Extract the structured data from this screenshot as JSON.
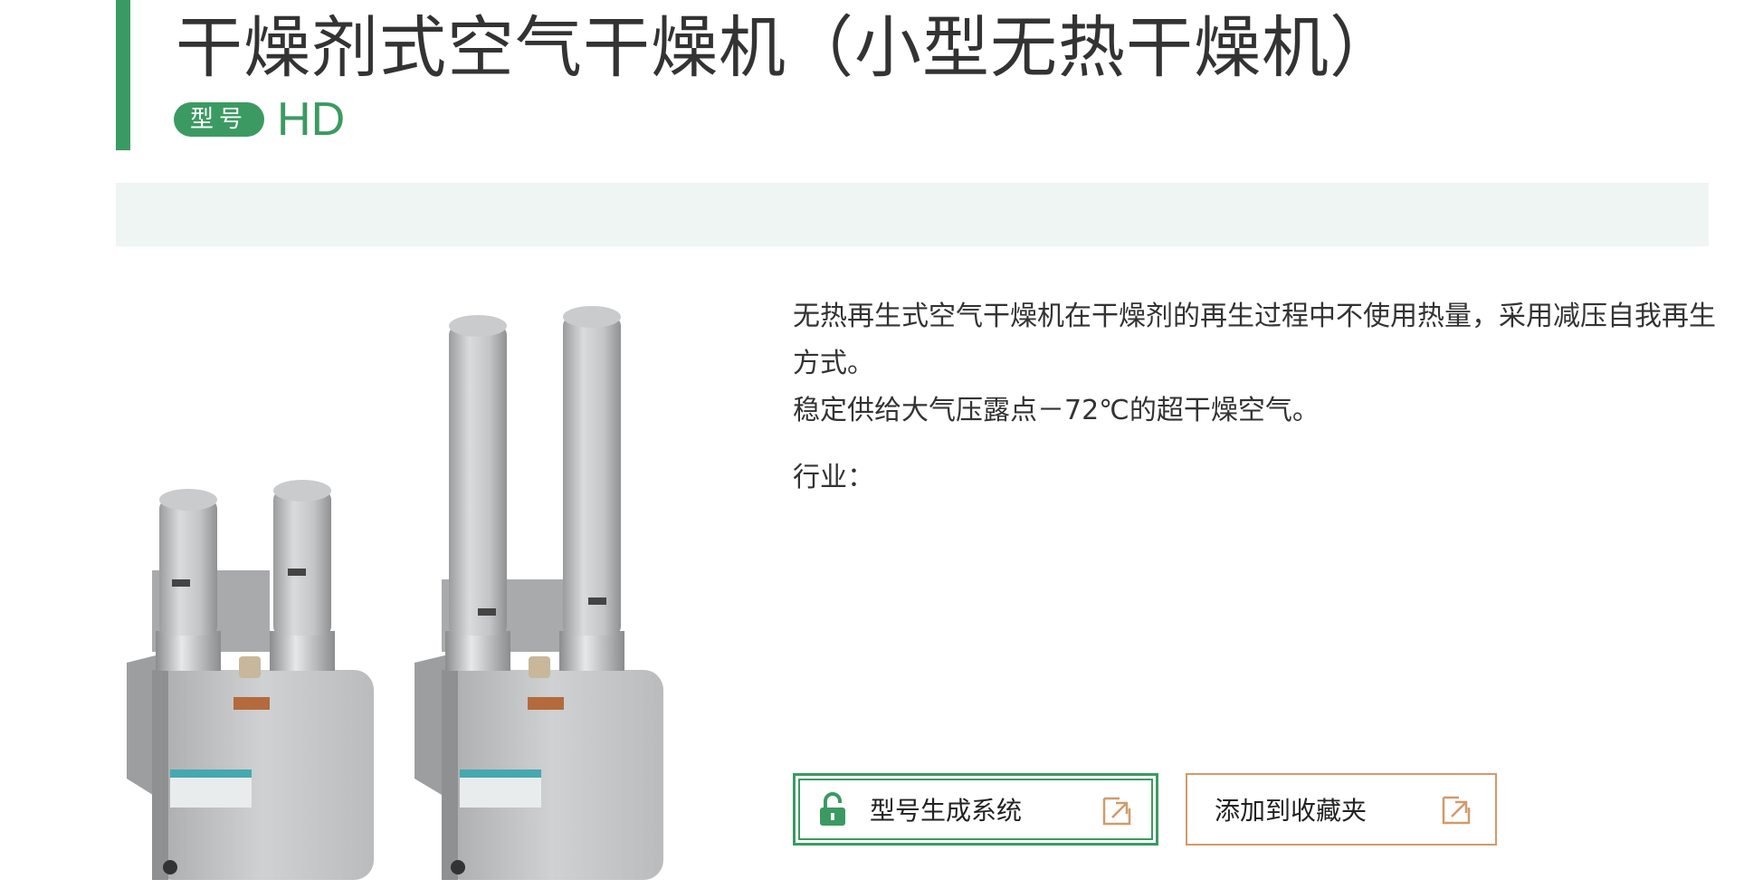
{
  "header": {
    "title": "干燥剂式空气干燥机（小型无热干燥机）",
    "model_label": "型号",
    "model_code": "HD"
  },
  "product": {
    "description_lines": [
      "无热再生式空气干燥机在干燥剂的再生过程中不使用热量，采用减压自我再生方式。",
      "稳定供给大气压露点－72℃的超干燥空气。"
    ],
    "industry_label": "行业："
  },
  "actions": {
    "model_generator_label": "型号生成系统",
    "add_favorites_label": "添加到收藏夹"
  },
  "icons": {
    "lock": "lock-icon",
    "external_link": "external-link-icon"
  },
  "colors": {
    "accent_green": "#3b9a62",
    "accent_orange": "#d29a6c",
    "band_bg": "#eef5f3"
  }
}
